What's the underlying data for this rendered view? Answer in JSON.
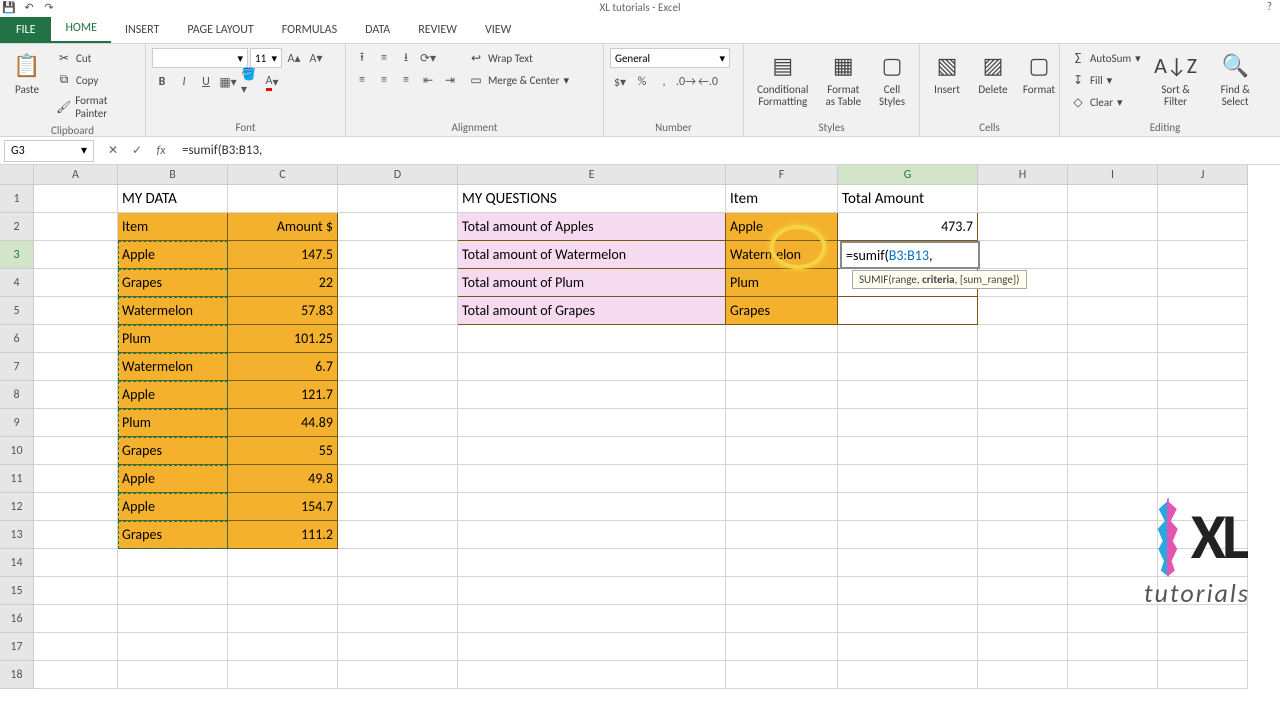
{
  "window": {
    "title": "XL tutorials - Excel"
  },
  "tabs": {
    "file": "FILE",
    "home": "HOME",
    "insert": "INSERT",
    "page_layout": "PAGE LAYOUT",
    "formulas": "FORMULAS",
    "data": "DATA",
    "review": "REVIEW",
    "view": "VIEW"
  },
  "ribbon": {
    "clipboard": {
      "label": "Clipboard",
      "paste": "Paste",
      "cut": "Cut",
      "copy": "Copy",
      "fp": "Format Painter"
    },
    "font": {
      "label": "Font",
      "name": "",
      "size": "11"
    },
    "alignment": {
      "label": "Alignment",
      "wrap": "Wrap Text",
      "merge": "Merge & Center"
    },
    "number": {
      "label": "Number",
      "format": "General"
    },
    "styles": {
      "label": "Styles",
      "cond": "Conditional Formatting",
      "table": "Format as Table",
      "cell": "Cell Styles"
    },
    "cells": {
      "label": "Cells",
      "insert": "Insert",
      "delete": "Delete",
      "format": "Format"
    },
    "editing": {
      "label": "Editing",
      "sum": "AutoSum",
      "fill": "Fill",
      "clear": "Clear",
      "sort": "Sort & Filter",
      "find": "Find & Select"
    }
  },
  "formula_bar": {
    "name_box": "G3",
    "formula": "=sumif(B3:B13,"
  },
  "col_headers": [
    "A",
    "B",
    "C",
    "D",
    "E",
    "F",
    "G",
    "H",
    "I",
    "J"
  ],
  "rows": [
    "1",
    "2",
    "3",
    "4",
    "5",
    "6",
    "7",
    "8",
    "9",
    "10",
    "11",
    "12",
    "13",
    "14",
    "15",
    "16",
    "17",
    "18"
  ],
  "sheet": {
    "b1": "MY DATA",
    "b2": "Item",
    "c2": "Amount $",
    "b3": "Apple",
    "c3": "147.5",
    "b4": "Grapes",
    "c4": "22",
    "b5": "Watermelon",
    "c5": "57.83",
    "b6": "Plum",
    "c6": "101.25",
    "b7": "Watermelon",
    "c7": "6.7",
    "b8": "Apple",
    "c8": "121.7",
    "b9": "Plum",
    "c9": "44.89",
    "b10": "Grapes",
    "c10": "55",
    "b11": "Apple",
    "c11": "49.8",
    "b12": "Apple",
    "c12": "154.7",
    "b13": "Grapes",
    "c13": "111.2",
    "e1": "MY QUESTIONS",
    "f1": "Item",
    "g1": "Total Amount",
    "e2": "Total amount of Apples",
    "f2": "Apple",
    "g2": "473.7",
    "e3": "Total amount of Watermelon",
    "f3": "Watermelon",
    "e4": "Total amount of Plum",
    "f4": "Plum",
    "e5": "Total amount of Grapes",
    "f5": "Grapes"
  },
  "edit": {
    "prefix": "=sumif(",
    "ref": "B3:B13",
    "suffix": ",",
    "hint_fn": "SUMIF(range, ",
    "hint_bold": "criteria",
    "hint_rest": ", [sum_range])"
  },
  "logo": {
    "xl": "XL",
    "sub": "tutorials"
  }
}
